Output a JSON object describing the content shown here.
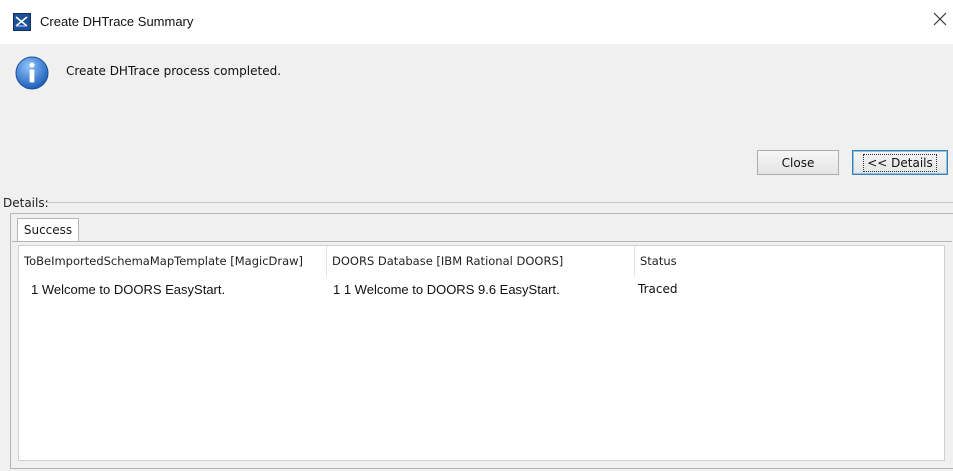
{
  "window": {
    "title": "Create DHTrace Summary",
    "icon": "app-icon",
    "close_glyph": "✕"
  },
  "message": {
    "icon": "info-icon",
    "text": "Create DHTrace process completed."
  },
  "buttons": {
    "close_label": "Close",
    "details_label": "<< Details"
  },
  "details": {
    "label": "Details:",
    "tabs": [
      {
        "label": "Success",
        "active": true
      }
    ],
    "table": {
      "columns": [
        "ToBeImportedSchemaMapTemplate [MagicDraw]",
        "DOORS Database [IBM Rational DOORS]",
        "Status"
      ],
      "rows": [
        [
          "1 Welcome to DOORS EasyStart.",
          "1 1 Welcome to DOORS 9.6 EasyStart.",
          "Traced"
        ]
      ]
    }
  },
  "colors": {
    "panel": "#f0f0f0",
    "info_blue": "#2a6fc2",
    "focus_border": "#3c7fb1"
  }
}
